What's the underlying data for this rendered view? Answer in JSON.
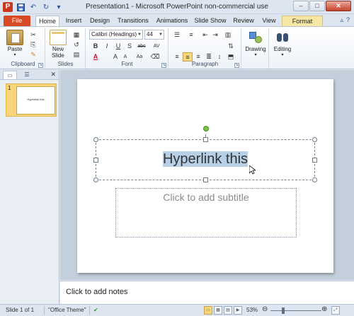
{
  "window": {
    "title": "Presentation1 - Microsoft PowerPoint non-commercial use",
    "buttons": {
      "minimize": "–",
      "maximize": "□",
      "close": "✕"
    }
  },
  "qat": {
    "app_icon": "P",
    "save": "💾",
    "undo": "↶",
    "redo": "↻",
    "customize": "▾"
  },
  "tabs": [
    {
      "label": "File"
    },
    {
      "label": "Home"
    },
    {
      "label": "Insert"
    },
    {
      "label": "Design"
    },
    {
      "label": "Transitions"
    },
    {
      "label": "Animations"
    },
    {
      "label": "Slide Show"
    },
    {
      "label": "Review"
    },
    {
      "label": "View"
    },
    {
      "label": "Format"
    }
  ],
  "ribbon": {
    "clipboard": {
      "label": "Clipboard",
      "paste": "Paste"
    },
    "slides": {
      "label": "Slides",
      "new_slide_line1": "New",
      "new_slide_line2": "Slide"
    },
    "font": {
      "label": "Font",
      "font_name": "Calibri (Headings)",
      "font_size": "44",
      "bold": "B",
      "italic": "I",
      "underline": "U",
      "strike": "S",
      "shadow": "abc",
      "spacing": "AV",
      "font_color": "A",
      "grow": "A",
      "shrink": "A",
      "clear": "Aa"
    },
    "paragraph": {
      "label": "Paragraph"
    },
    "drawing": {
      "label": "Drawing"
    },
    "editing": {
      "label": "Editing"
    }
  },
  "slide_pane": {
    "slide_number": "1",
    "thumb_text": "Hyperlink this"
  },
  "slide": {
    "title_text": "Hyperlink this",
    "subtitle_placeholder": "Click to add subtitle"
  },
  "notes": {
    "placeholder": "Click to add notes"
  },
  "status": {
    "slide_info": "Slide 1 of 1",
    "theme": "\"Office Theme\"",
    "zoom": "53%"
  },
  "colors": {
    "file_tab": "#d84a24",
    "selection": "#b8cfe8",
    "thumb_highlight": "#f7d57a"
  }
}
